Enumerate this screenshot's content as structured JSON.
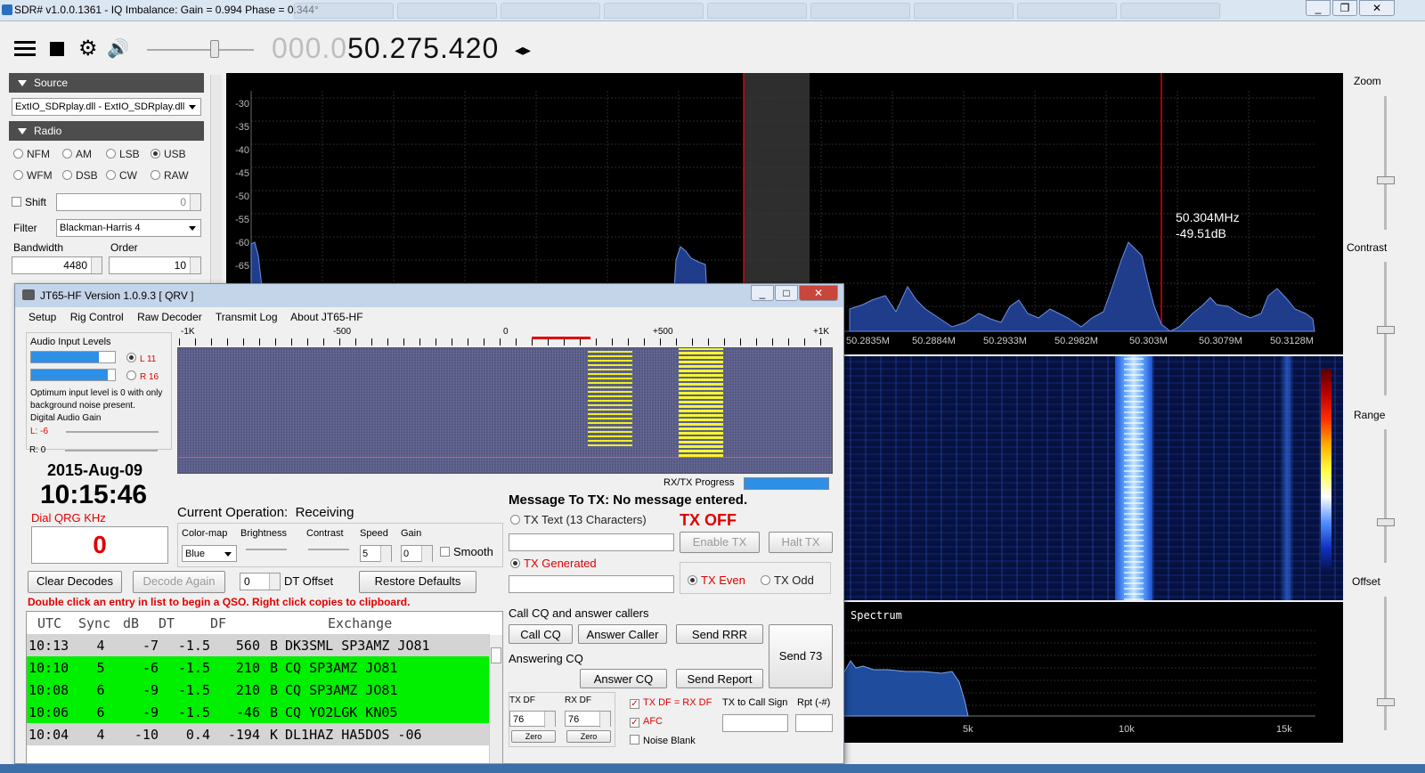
{
  "sdr": {
    "title": "SDR# v1.0.0.1361 - IQ Imbalance: Gain = 0.994 Phase = 0.344°",
    "freq_dim": "000.0",
    "freq_main": "50.275.420",
    "source_label": "Source",
    "source_value": "ExtIO_SDRplay.dll - ExtIO_SDRplay.dll",
    "radio_label": "Radio",
    "modes": [
      "NFM",
      "AM",
      "LSB",
      "USB",
      "WFM",
      "DSB",
      "CW",
      "RAW"
    ],
    "shift_label": "Shift",
    "shift_value": "0",
    "filter_label": "Filter",
    "filter_value": "Blackman-Harris 4",
    "bandwidth_label": "Bandwidth",
    "bandwidth_value": "4480",
    "order_label": "Order",
    "order_value": "10",
    "db_ticks": [
      "-30",
      "-35",
      "-40",
      "-45",
      "-50",
      "-55",
      "-60",
      "-65"
    ],
    "freq_ticks": [
      "50.2835M",
      "50.2884M",
      "50.2933M",
      "50.2982M",
      "50.303M",
      "50.3079M",
      "50.3128M"
    ],
    "cursor_freq": "50.304MHz",
    "cursor_db": "-49.51dB",
    "spectrum_label": "Spectrum",
    "spec2_ticks": [
      "5k",
      "10k",
      "15k"
    ],
    "zoom": "Zoom",
    "contrast": "Contrast",
    "range": "Range",
    "offset": "Offset"
  },
  "jt": {
    "title": "JT65-HF Version 1.0.9.3  [ QRV ]",
    "menu": [
      "Setup",
      "Rig Control",
      "Raw Decoder",
      "Transmit Log",
      "About JT65-HF"
    ],
    "audio_label": "Audio Input Levels",
    "l_level": "L 11",
    "r_level": "R 16",
    "optimum_note": "Optimum input level is 0 with only background noise present.",
    "digital_gain": "Digital Audio Gain",
    "l_gain": "L: -6",
    "r_gain": "R: 0",
    "date": "2015-Aug-09",
    "time": "10:15:46",
    "dial_label": "Dial QRG KHz",
    "dial_value": "0",
    "scale": [
      "-1K",
      "-500",
      "0",
      "+500",
      "+1K"
    ],
    "rxtx_progress": "RX/TX Progress",
    "current_op_label": "Current Operation:",
    "current_op": "Receiving",
    "colormap_label": "Color-map",
    "colormap": "Blue",
    "brightness": "Brightness",
    "contrast": "Contrast",
    "speed_label": "Speed",
    "speed": "5",
    "gain_label": "Gain",
    "gain": "0",
    "smooth": "Smooth",
    "clear_decodes": "Clear Decodes",
    "decode_again": "Decode Again",
    "dt_value": "0",
    "dt_offset": "DT Offset",
    "restore_defaults": "Restore Defaults",
    "hint": "Double click an entry in list to begin a QSO.  Right click copies to clipboard.",
    "headers": [
      "UTC",
      "Sync",
      "dB",
      "DT",
      "DF",
      "",
      "Exchange"
    ],
    "rows": [
      {
        "utc": "10:13",
        "sync": "4",
        "db": "-7",
        "dt": "-1.5",
        "df": "560",
        "m": "B",
        "ex": "DK3SML SP3AMZ JO81",
        "hl": "gray"
      },
      {
        "utc": "10:10",
        "sync": "5",
        "db": "-6",
        "dt": "-1.5",
        "df": "210",
        "m": "B",
        "ex": "CQ SP3AMZ JO81",
        "hl": "green"
      },
      {
        "utc": "10:08",
        "sync": "6",
        "db": "-9",
        "dt": "-1.5",
        "df": "210",
        "m": "B",
        "ex": "CQ SP3AMZ JO81",
        "hl": "green"
      },
      {
        "utc": "10:06",
        "sync": "6",
        "db": "-9",
        "dt": "-1.5",
        "df": "-46",
        "m": "B",
        "ex": "CQ YO2LGK KN05",
        "hl": "green"
      },
      {
        "utc": "10:04",
        "sync": "4",
        "db": "-10",
        "dt": "0.4",
        "df": "-194",
        "m": "K",
        "ex": "DL1HAZ HA5DOS -06",
        "hl": "gray"
      }
    ],
    "msg_to_tx": "Message To TX:  No message entered.",
    "tx_text": "TX Text (13 Characters)",
    "tx_off": "TX OFF",
    "enable_tx": "Enable TX",
    "halt_tx": "Halt TX",
    "tx_generated": "TX Generated",
    "tx_even": "TX Even",
    "tx_odd": "TX Odd",
    "call_cq_label": "Call CQ and answer callers",
    "call_cq": "Call CQ",
    "answer_caller": "Answer Caller",
    "send_rrr": "Send RRR",
    "send_73": "Send 73",
    "answering_cq": "Answering CQ",
    "answer_cq": "Answer CQ",
    "send_report": "Send Report",
    "tx_df_label": "TX DF",
    "tx_df": "76",
    "rx_df_label": "RX DF",
    "rx_df": "76",
    "zero": "Zero",
    "txdf_eq_rxdf": "TX DF = RX DF",
    "afc": "AFC",
    "noise_blank": "Noise Blank",
    "tx_to_call": "TX to Call Sign",
    "rpt": "Rpt (-#)"
  }
}
